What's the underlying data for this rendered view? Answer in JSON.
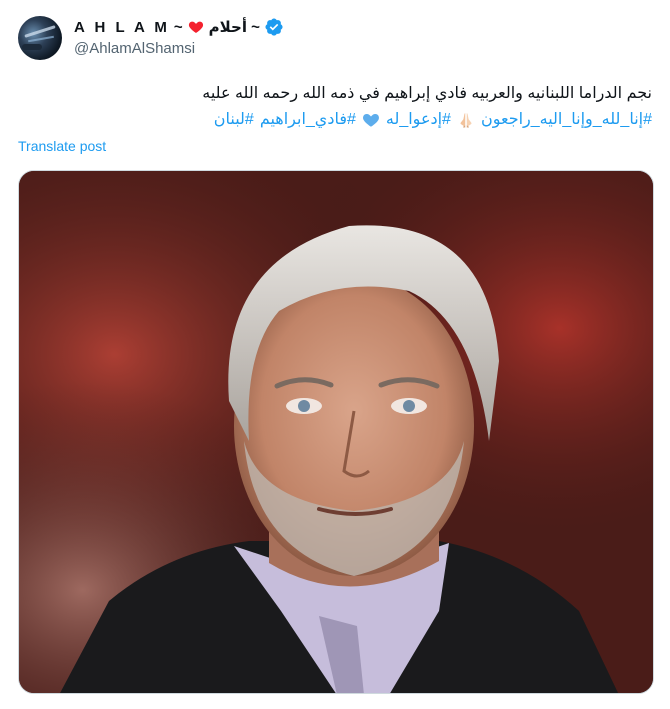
{
  "author": {
    "display_name": "A H L A M",
    "name_suffix": "~ أحلام ~",
    "handle": "@AhlamAlShamsi",
    "verified": true,
    "avatar_icon": "avatar-image"
  },
  "post": {
    "line1": "نجم الدراما اللبنانيه والعربيه فادي إبراهيم  في ذمه الله رحمه الله عليه",
    "hashtags": [
      "#إنا_لله_وإنا_اليه_راجعون",
      "#إدعوا_له",
      "#فادي_ابراهيم",
      "#لبنان"
    ],
    "emojis": [
      "praying-hands",
      "blue-heart"
    ],
    "translate_label": "Translate post"
  },
  "media": {
    "alt": "photo",
    "description_icon": "portrait-photo"
  },
  "colors": {
    "accent": "#1d9bf0",
    "text": "#0f1419",
    "muted": "#536471",
    "heart": "#f4212e"
  }
}
